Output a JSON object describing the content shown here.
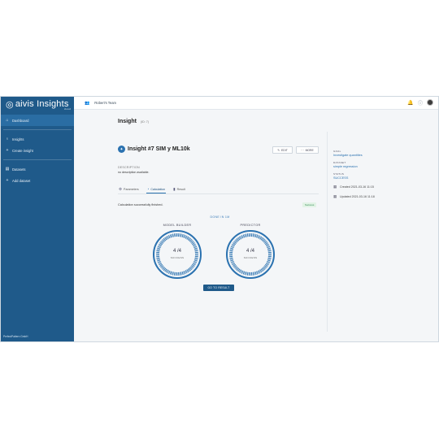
{
  "app": {
    "logo_text": "aivis Insights",
    "logo_sub": "cloud"
  },
  "sidebar": {
    "items": [
      {
        "label": "Dashboard",
        "icon": "home-icon"
      },
      {
        "label": "Insights",
        "icon": "bulb-icon"
      },
      {
        "label": "Create insight",
        "icon": "plus-icon"
      },
      {
        "label": "Datasets",
        "icon": "database-icon"
      },
      {
        "label": "Add dataset",
        "icon": "plus-icon"
      }
    ],
    "footer": "PerfectPattern GmbH"
  },
  "topbar": {
    "team": "Robert's Team"
  },
  "page": {
    "title": "Insight",
    "id": "(ID: 7)"
  },
  "insight": {
    "name": "Insight #7 SIM y ML10k",
    "edit_label": "EDIT",
    "more_label": "MORE",
    "description_label": "DESCRIPTION",
    "description_text": "no description available.",
    "tabs": [
      {
        "label": "Parameters"
      },
      {
        "label": "Calculation"
      },
      {
        "label": "Result"
      }
    ],
    "status_text": "Calculation successfully finished.",
    "status_chip": "Success",
    "done_in": "DONE IN 1M",
    "dials": [
      {
        "label": "MODEL BUILDER",
        "value": "4 /4",
        "sub": "SUCCESS",
        "progress": 1.0
      },
      {
        "label": "PREDICTOR",
        "value": "4 /4",
        "sub": "SUCCESS",
        "progress": 1.0
      }
    ],
    "goto_label": "GO TO RESULT"
  },
  "meta": {
    "goal_label": "GOAL",
    "goal_value": "Investigate quantities",
    "dataset_label": "DATASET",
    "dataset_value": "simple regression",
    "status_label": "STATUS",
    "status_value": "SUCCESS",
    "created": "Created 2021-03-16 11:15",
    "updated": "Updated 2021-03-16 11:18"
  },
  "colors": {
    "sidebar": "#1f5a8a",
    "accent": "#2b72b0",
    "success": "#2e8b4f"
  }
}
